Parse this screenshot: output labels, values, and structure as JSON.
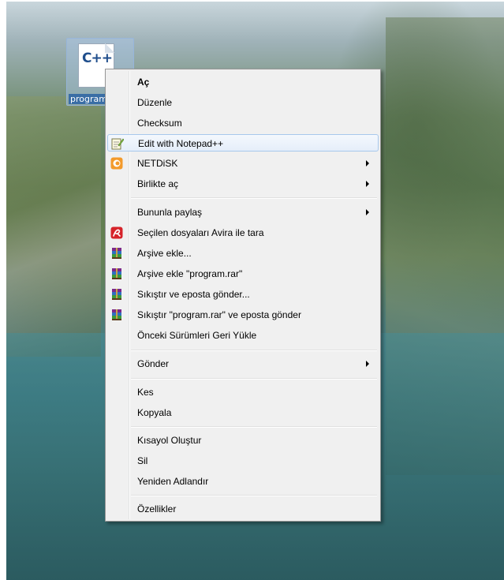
{
  "desktop": {
    "file_icon_text": "C++",
    "file_label": "program"
  },
  "context_menu": {
    "items": [
      {
        "label": "Aç",
        "bold": true
      },
      {
        "label": "Düzenle"
      },
      {
        "label": "Checksum"
      },
      {
        "label": "Edit with Notepad++",
        "icon": "notepad-plus-plus-icon",
        "highlighted": true
      },
      {
        "label": "NETDiSK",
        "icon": "netdisk-icon",
        "submenu": true
      },
      {
        "label": "Birlikte aç",
        "submenu": true
      },
      {
        "label": "Bununla paylaş",
        "submenu": true
      },
      {
        "label": "Seçilen dosyaları Avira ile tara",
        "icon": "avira-icon"
      },
      {
        "label": "Arşive ekle...",
        "icon": "winrar-icon"
      },
      {
        "label": "Arşive ekle \"program.rar\"",
        "icon": "winrar-icon"
      },
      {
        "label": "Sıkıştır ve eposta gönder...",
        "icon": "winrar-icon"
      },
      {
        "label": "Sıkıştır \"program.rar\" ve eposta gönder",
        "icon": "winrar-icon"
      },
      {
        "label": "Önceki Sürümleri Geri Yükle"
      },
      {
        "label": "Gönder",
        "submenu": true
      },
      {
        "label": "Kes"
      },
      {
        "label": "Kopyala"
      },
      {
        "label": "Kısayol Oluştur"
      },
      {
        "label": "Sil"
      },
      {
        "label": "Yeniden Adlandır"
      },
      {
        "label": "Özellikler"
      }
    ]
  },
  "colors": {
    "menu_background": "#f0f0f0",
    "highlight_border": "#a8c8ec",
    "avira_red": "#d6232a"
  }
}
